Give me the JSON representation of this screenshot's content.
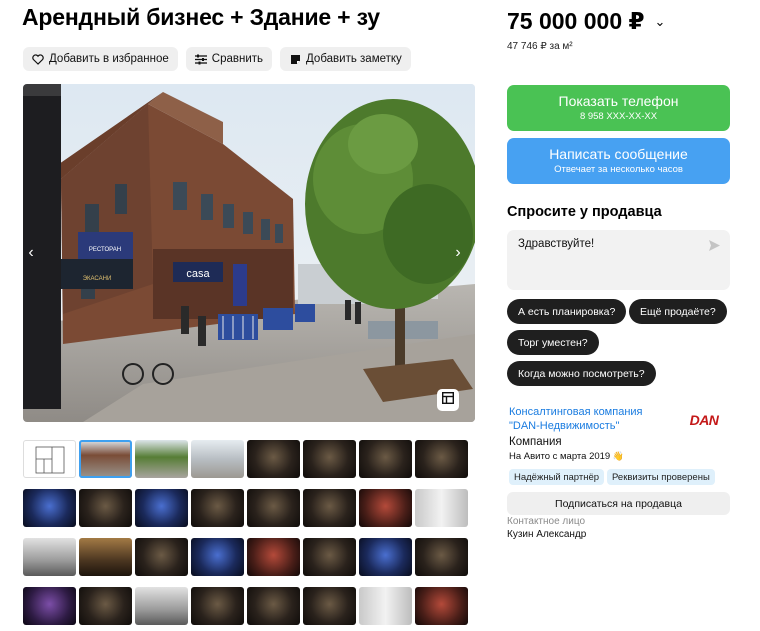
{
  "listing": {
    "title": "Арендный бизнес + Здание + зу",
    "price": "75 000 000 ₽",
    "price_per_sqm": "47 746 ₽ за м²"
  },
  "actions": {
    "favorite": "Добавить в избранное",
    "compare": "Сравнить",
    "note": "Добавить заметку"
  },
  "contact_buttons": {
    "phone_label": "Показать телефон",
    "phone_masked": "8 958 XXX-XX-XX",
    "message_label": "Написать сообщение",
    "message_sub": "Отвечает за несколько часов"
  },
  "ask": {
    "title": "Спросите у продавца",
    "message": "Здравствуйте!",
    "chips": [
      "А есть планировка?",
      "Ещё продаёте?",
      "Торг уместен?",
      "Когда можно посмотреть?"
    ]
  },
  "seller": {
    "name": "Консалтинговая компания \"DAN-Недвижимость\"",
    "logo_text": "DAN",
    "type": "Компания",
    "since": "На Авито с марта 2019",
    "badges": [
      "Надёжный партнёр",
      "Реквизиты проверены"
    ],
    "subscribe": "Подписаться на продавца",
    "contact_label": "Контактное лицо",
    "contact_name": "Кузин Александр"
  },
  "photo": {
    "sign_1": "РЕСТОРАН",
    "sign_2": "ЭКАСАНИ",
    "sign_3": "casa"
  },
  "gallery": {
    "active_index": 1,
    "thumbs": [
      {
        "kind": "plan"
      },
      {
        "kind": "street-a"
      },
      {
        "kind": "street-b"
      },
      {
        "kind": "street-c"
      },
      {
        "kind": "hall-dark"
      },
      {
        "kind": "hall-dark"
      },
      {
        "kind": "hall-dark"
      },
      {
        "kind": "hall-dark"
      },
      {
        "kind": "bar-blue"
      },
      {
        "kind": "hall-dark"
      },
      {
        "kind": "bar-blue"
      },
      {
        "kind": "hall-dark"
      },
      {
        "kind": "hall-dark"
      },
      {
        "kind": "hall-dark"
      },
      {
        "kind": "hall-red"
      },
      {
        "kind": "corridor"
      },
      {
        "kind": "kitchen"
      },
      {
        "kind": "stairs"
      },
      {
        "kind": "hall-dark"
      },
      {
        "kind": "bar-blue"
      },
      {
        "kind": "hall-red"
      },
      {
        "kind": "hall-dark"
      },
      {
        "kind": "bar-blue"
      },
      {
        "kind": "hall-dark"
      },
      {
        "kind": "hall-purple"
      },
      {
        "kind": "hall-dark"
      },
      {
        "kind": "kitchen"
      },
      {
        "kind": "hall-dark"
      },
      {
        "kind": "hall-dark"
      },
      {
        "kind": "hall-dark"
      },
      {
        "kind": "corridor"
      },
      {
        "kind": "hall-red"
      }
    ]
  }
}
